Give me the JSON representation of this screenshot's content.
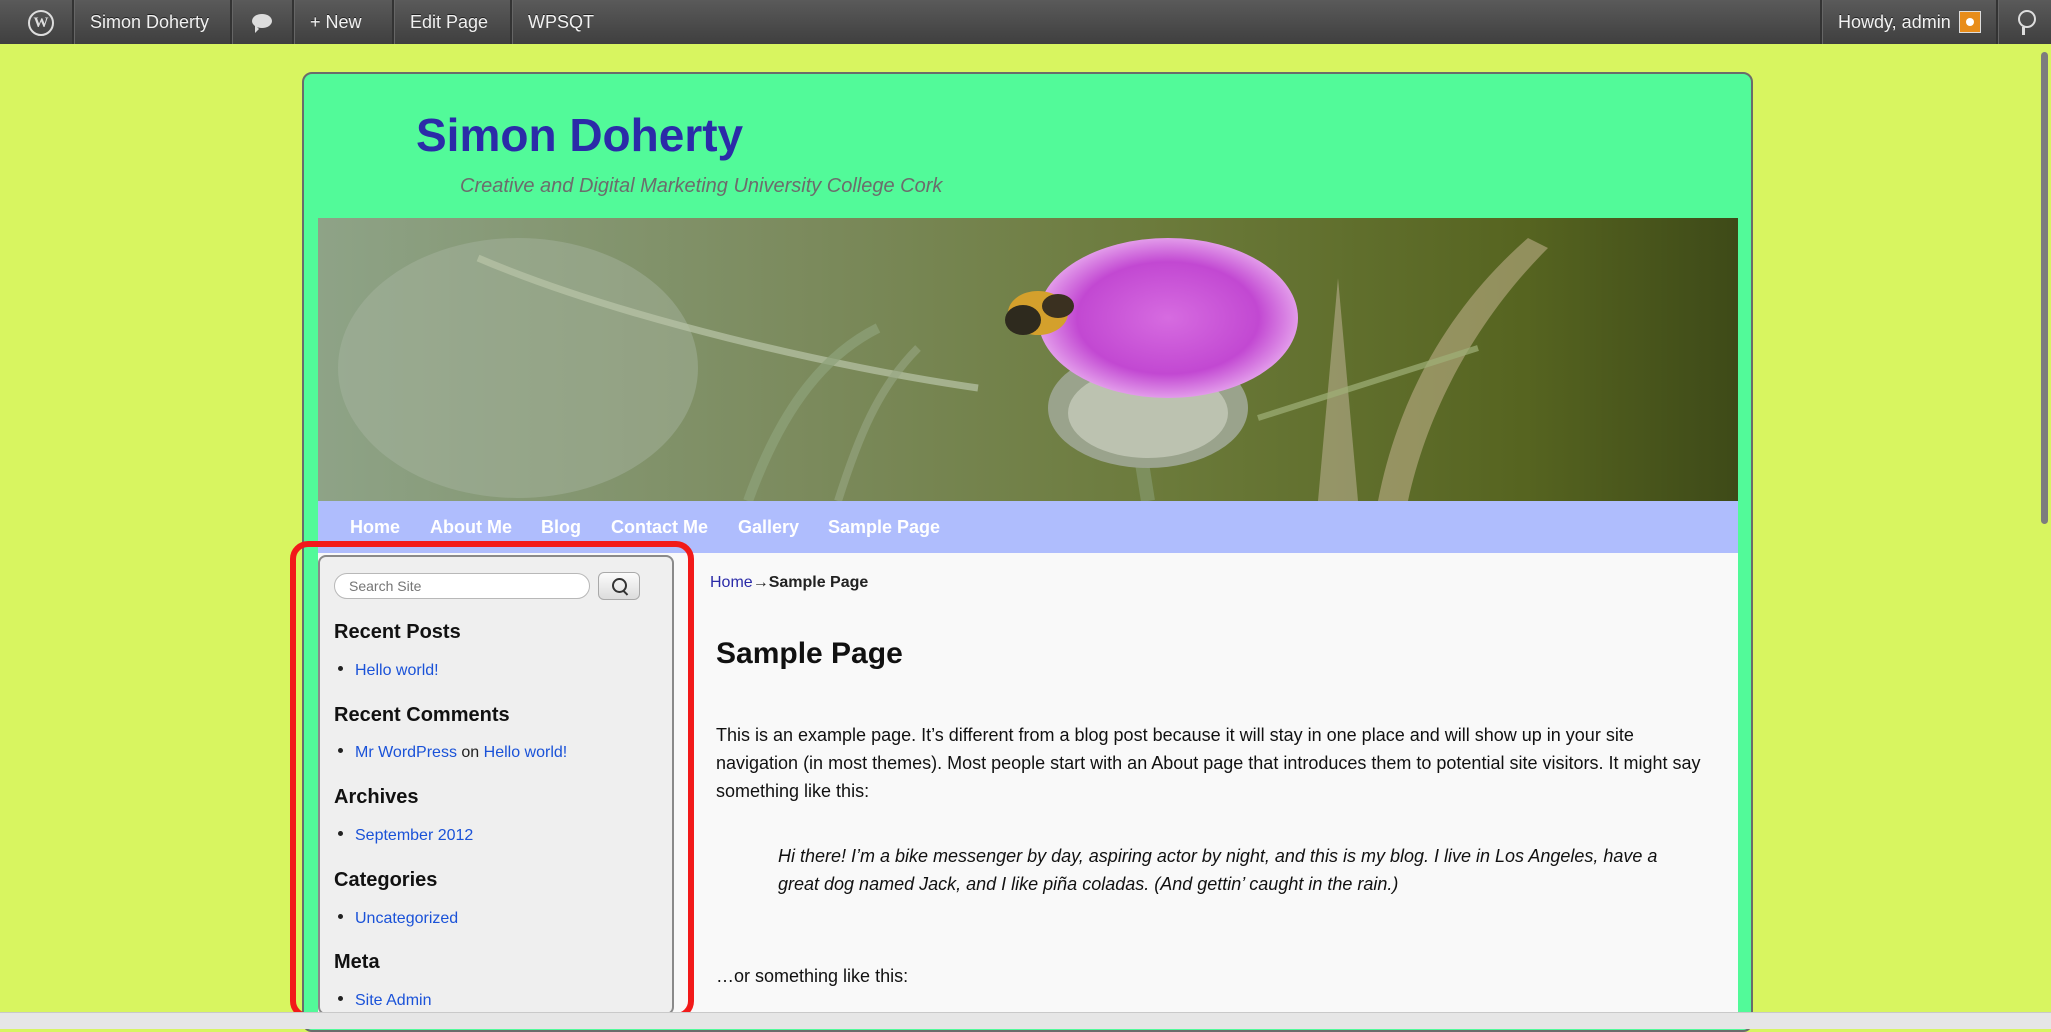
{
  "admin_bar": {
    "wp_logo": "W",
    "site_name": "Simon Doherty",
    "comments_icon": "comment-bubble-icon",
    "new_label": "+ New",
    "edit_page_label": "Edit Page",
    "wpsqt_label": "WPSQT",
    "howdy": "Howdy, admin",
    "search_icon": "search-icon"
  },
  "site": {
    "title": "Simon Doherty",
    "description": "Creative and Digital Marketing University College Cork"
  },
  "nav": {
    "items": [
      {
        "label": "Home"
      },
      {
        "label": "About Me"
      },
      {
        "label": "Blog"
      },
      {
        "label": "Contact Me"
      },
      {
        "label": "Gallery"
      },
      {
        "label": "Sample Page"
      }
    ]
  },
  "sidebar": {
    "search_placeholder": "Search Site",
    "recent_posts": {
      "title": "Recent Posts",
      "items": [
        "Hello world!"
      ]
    },
    "recent_comments": {
      "title": "Recent Comments",
      "author": "Mr WordPress",
      "on": "on",
      "post": "Hello world!"
    },
    "archives": {
      "title": "Archives",
      "items": [
        "September 2012"
      ]
    },
    "categories": {
      "title": "Categories",
      "items": [
        "Uncategorized"
      ]
    },
    "meta": {
      "title": "Meta",
      "items": [
        "Site Admin"
      ]
    }
  },
  "main": {
    "breadcrumb": {
      "home": "Home",
      "arrow": "→",
      "current": "Sample Page"
    },
    "title": "Sample Page",
    "paragraph1": "This is an example page. It’s different from a blog post because it will stay in one place and will show up in your site navigation (in most themes). Most people start with an About page that introduces them to potential site visitors. It might say something like this:",
    "quote": "Hi there! I’m a bike messenger by day, aspiring actor by night, and this is my blog. I live in Los Angeles, have a great dog named Jack, and I like piña coladas. (And gettin’ caught in the rain.)",
    "paragraph2": "…or something like this:"
  },
  "colors": {
    "page_bg": "#d8f560",
    "wrapper_bg": "#52fa99",
    "nav_bg": "#afbdfd",
    "title_color": "#2b2ba8",
    "link_color": "#1a52d8",
    "highlight": "#f21a1a"
  }
}
